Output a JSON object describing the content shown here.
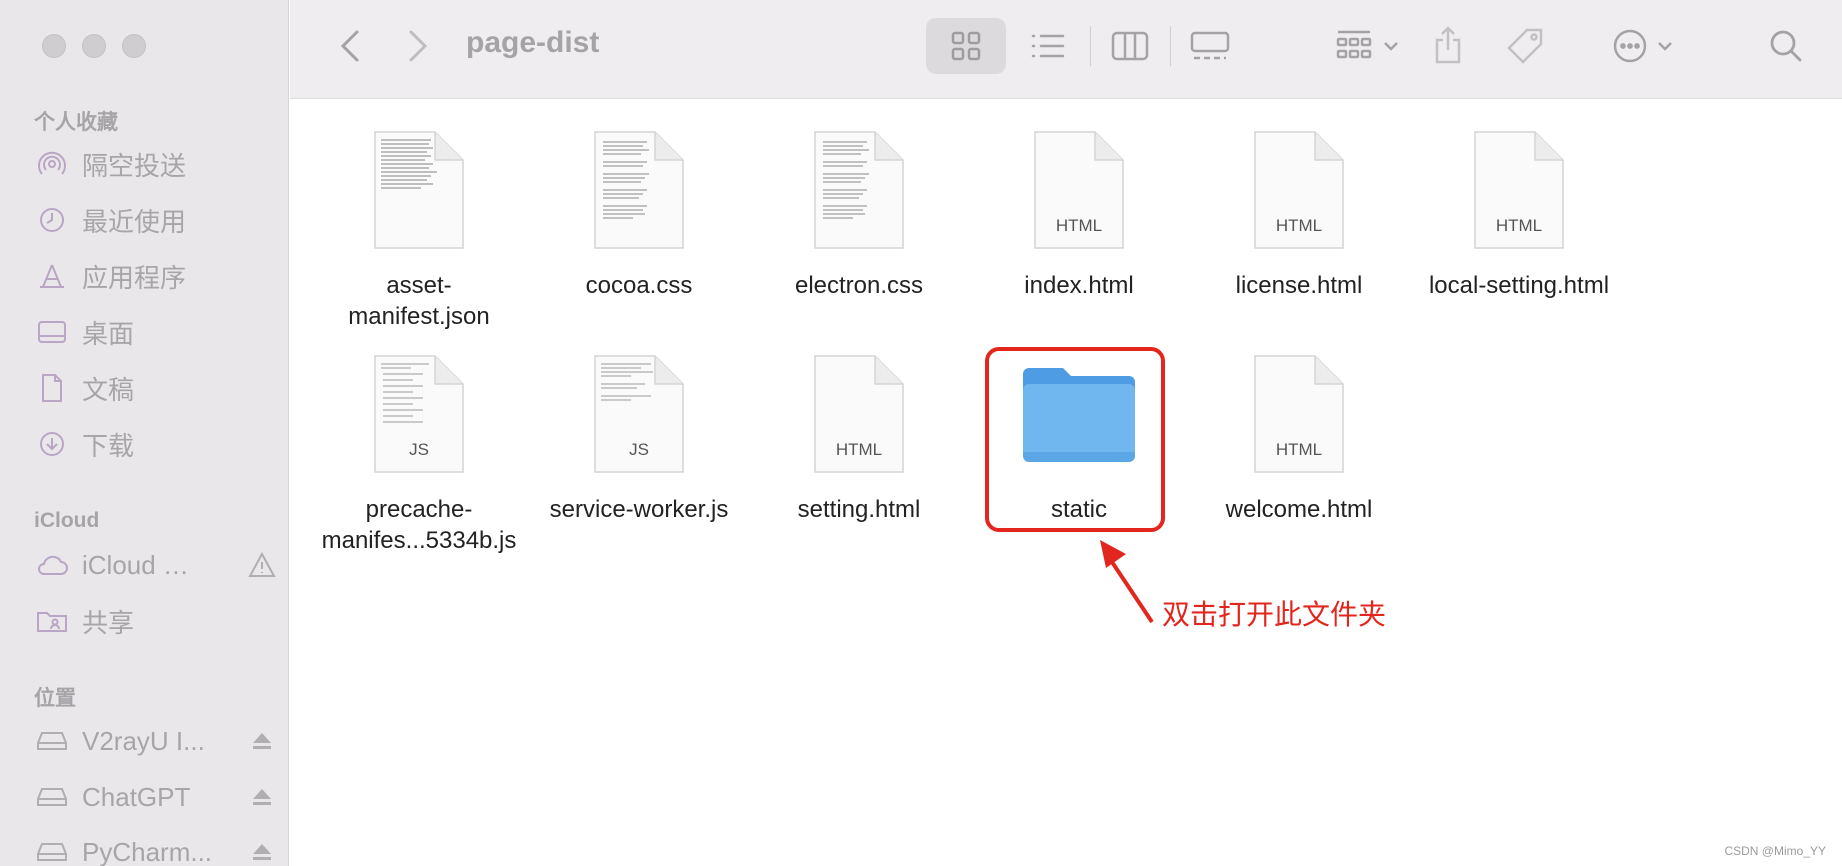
{
  "window": {
    "title": "page-dist"
  },
  "sidebar": {
    "favorites_title": "个人收藏",
    "favorites": [
      {
        "label": "隔空投送",
        "icon": "airdrop-icon"
      },
      {
        "label": "最近使用",
        "icon": "clock-icon"
      },
      {
        "label": "应用程序",
        "icon": "applications-icon"
      },
      {
        "label": "桌面",
        "icon": "desktop-icon"
      },
      {
        "label": "文稿",
        "icon": "document-icon"
      },
      {
        "label": "下载",
        "icon": "download-icon"
      }
    ],
    "icloud_title": "iCloud",
    "icloud": [
      {
        "label": "iCloud …",
        "icon": "cloud-icon",
        "trail_icon": "warning-icon"
      },
      {
        "label": "共享",
        "icon": "shared-folder-icon"
      }
    ],
    "locations_title": "位置",
    "locations": [
      {
        "label": "V2rayU I...",
        "icon": "drive-icon",
        "trail_icon": "eject-icon"
      },
      {
        "label": "ChatGPT",
        "icon": "drive-icon",
        "trail_icon": "eject-icon"
      },
      {
        "label": "PyCharm...",
        "icon": "drive-icon",
        "trail_icon": "eject-icon"
      }
    ]
  },
  "files": [
    {
      "name": "asset-\nmanifest.json",
      "kind": "text-dense",
      "label": ""
    },
    {
      "name": "cocoa.css",
      "kind": "text",
      "label": ""
    },
    {
      "name": "electron.css",
      "kind": "text",
      "label": ""
    },
    {
      "name": "index.html",
      "kind": "doc",
      "label": "HTML"
    },
    {
      "name": "license.html",
      "kind": "doc",
      "label": "HTML"
    },
    {
      "name": "local-setting.html",
      "kind": "doc",
      "label": "HTML"
    },
    {
      "name": "precache-\nmanifes...5334b.js",
      "kind": "code",
      "label": "JS"
    },
    {
      "name": "service-worker.js",
      "kind": "code",
      "label": "JS"
    },
    {
      "name": "setting.html",
      "kind": "doc",
      "label": "HTML"
    },
    {
      "name": "static",
      "kind": "folder",
      "label": ""
    },
    {
      "name": "welcome.html",
      "kind": "doc",
      "label": "HTML"
    }
  ],
  "annotation": {
    "text": "双击打开此文件夹",
    "color": "#e2261d"
  },
  "watermark": "CSDN @Mimo_YY",
  "colors": {
    "accent": "#e2261d",
    "folder": "#6fb7ee",
    "sidebar_text": "#a8a5a9"
  }
}
